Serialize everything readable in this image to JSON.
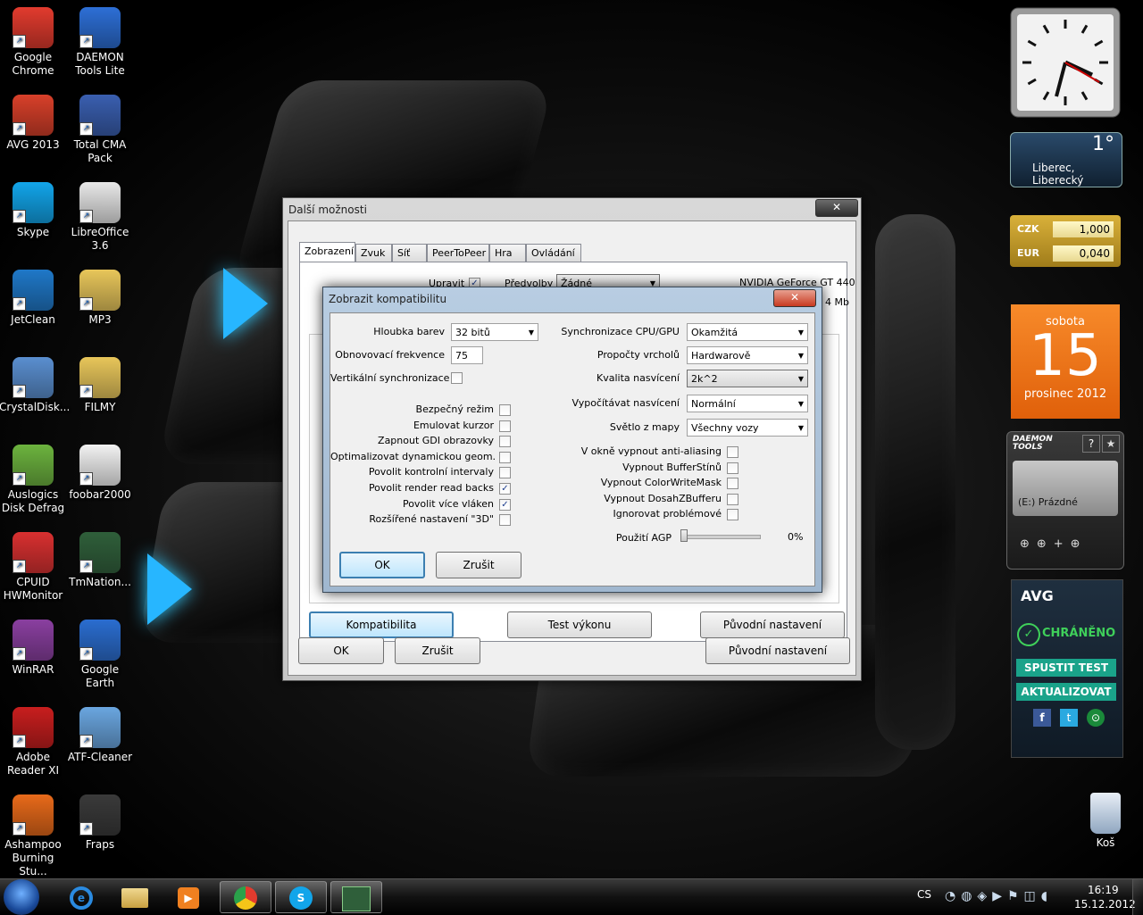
{
  "desktop": {
    "icons": [
      {
        "label1": "Google",
        "label2": "Chrome",
        "icon": "chrome-icon",
        "color": "#e23b2e"
      },
      {
        "label1": "DAEMON",
        "label2": "Tools Lite",
        "icon": "daemon-tools-icon",
        "color": "#2d6fd6"
      },
      {
        "label1": "AVG 2013",
        "label2": "",
        "icon": "avg-icon",
        "color": "#d8402a"
      },
      {
        "label1": "Total CMA",
        "label2": "Pack",
        "icon": "floppy-icon",
        "color": "#3a5fb0"
      },
      {
        "label1": "Skype",
        "label2": "",
        "icon": "skype-icon",
        "color": "#12a5ea"
      },
      {
        "label1": "LibreOffice",
        "label2": "3.6",
        "icon": "document-icon",
        "color": "#e8e8e8"
      },
      {
        "label1": "JetClean",
        "label2": "",
        "icon": "jetclean-icon",
        "color": "#1f78c8"
      },
      {
        "label1": "MP3",
        "label2": "",
        "icon": "folder-icon",
        "color": "#e8c65a"
      },
      {
        "label1": "CrystalDisk...",
        "label2": "",
        "icon": "crystaldisk-icon",
        "color": "#5a8fd0"
      },
      {
        "label1": "FILMY",
        "label2": "",
        "icon": "folder-icon",
        "color": "#e8c65a"
      },
      {
        "label1": "Auslogics",
        "label2": "Disk Defrag",
        "icon": "defrag-icon",
        "color": "#6cb33e"
      },
      {
        "label1": "foobar2000",
        "label2": "",
        "icon": "foobar-icon",
        "color": "#f2f2f2"
      },
      {
        "label1": "CPUID",
        "label2": "HWMonitor",
        "icon": "hwmonitor-icon",
        "color": "#d93030"
      },
      {
        "label1": "TmNation...",
        "label2": "",
        "icon": "tmnations-icon",
        "color": "#2f5f3a"
      },
      {
        "label1": "WinRAR",
        "label2": "",
        "icon": "winrar-icon",
        "color": "#8a3fa0"
      },
      {
        "label1": "Google Earth",
        "label2": "",
        "icon": "google-earth-icon",
        "color": "#2a6dd0"
      },
      {
        "label1": "Adobe",
        "label2": "Reader XI",
        "icon": "adobe-reader-icon",
        "color": "#c81e1e"
      },
      {
        "label1": "ATF-Cleaner",
        "label2": "",
        "icon": "atf-cleaner-icon",
        "color": "#6aa6e0"
      },
      {
        "label1": "Ashampoo",
        "label2": "Burning Stu...",
        "icon": "ashampoo-icon",
        "color": "#e86a1a"
      },
      {
        "label1": "Fraps",
        "label2": "",
        "icon": "fraps-icon",
        "color": "#3a3a3a"
      }
    ],
    "recycle_bin": "Koš"
  },
  "gadgets": {
    "weather": {
      "temp": "1°",
      "place": "Liberec, Liberecký"
    },
    "currency": [
      {
        "code": "CZK",
        "value": "1,000"
      },
      {
        "code": "EUR",
        "value": "0,040"
      }
    ],
    "calendar": {
      "weekday": "sobota",
      "day": "15",
      "month_year": "prosinec 2012"
    },
    "daemon": {
      "brand": "DAEMON TOOLS",
      "help": "?",
      "drive": "(E:) Prázdné"
    },
    "avg": {
      "brand": "AVG",
      "status": "CHRÁNĚNO",
      "btn_test": "SPUSTIT TEST",
      "btn_update": "AKTUALIZOVAT"
    }
  },
  "main_window": {
    "title": "Další možnosti",
    "close": "✕",
    "tabs": [
      "Zobrazení",
      "Zvuk",
      "Síť",
      "PeerToPeer",
      "Hra",
      "Ovládání"
    ],
    "upravit_label": "Upravit",
    "predvolby_label": "Předvolby",
    "predvolby_value": "Žádné",
    "gpu_name": "NVIDIA GeForce GT 440",
    "mem_suffix": "4 Mb",
    "btn_compat": "Kompatibilita",
    "btn_perf": "Test výkonu",
    "btn_default_inner": "Původní nastavení",
    "btn_ok": "OK",
    "btn_cancel": "Zrušit",
    "btn_default": "Původní nastavení"
  },
  "compat_dialog": {
    "title": "Zobrazit kompatibilitu",
    "close": "✕",
    "color_depth_label": "Hloubka barev",
    "color_depth_value": "32 bitů",
    "refresh_label": "Obnovovací frekvence",
    "refresh_value": "75",
    "vsync_label": "Vertikální synchronizace",
    "left_checks": [
      {
        "label": "Bezpečný režim",
        "checked": false
      },
      {
        "label": "Emulovat kurzor",
        "checked": false
      },
      {
        "label": "Zapnout GDI obrazovky",
        "checked": false
      },
      {
        "label": "Optimalizovat dynamickou geom.",
        "checked": false
      },
      {
        "label": "Povolit kontrolní intervaly",
        "checked": false
      },
      {
        "label": "Povolit render read backs",
        "checked": true
      },
      {
        "label": "Povolit více vláken",
        "checked": true
      },
      {
        "label": "Rozšířené nastavení \"3D\"",
        "checked": false
      }
    ],
    "right_selects": [
      {
        "label": "Synchronizace CPU/GPU",
        "value": "Okamžitá"
      },
      {
        "label": "Propočty vrcholů",
        "value": "Hardwarově"
      },
      {
        "label": "Kvalita nasvícení",
        "value": "2k^2"
      },
      {
        "label": "Vypočítávat nasvícení",
        "value": "Normální"
      },
      {
        "label": "Světlo z mapy",
        "value": "Všechny vozy"
      }
    ],
    "right_checks": [
      {
        "label": "V okně vypnout anti-aliasing",
        "checked": false
      },
      {
        "label": "Vypnout BufferStínů",
        "checked": false
      },
      {
        "label": "Vypnout ColorWriteMask",
        "checked": false
      },
      {
        "label": "Vypnout DosahZBufferu",
        "checked": false
      },
      {
        "label": "Ignorovat problémové",
        "checked": false
      }
    ],
    "agp_label": "Použití AGP",
    "agp_value": "0%",
    "agp_fraction": 0,
    "btn_ok": "OK",
    "btn_cancel": "Zrušit"
  },
  "taskbar": {
    "lang": "CS",
    "time": "16:19",
    "date": "15.12.2012",
    "items": [
      "start-orb",
      "internet-explorer-icon",
      "explorer-icon",
      "media-player-icon",
      "chrome-icon",
      "skype-icon",
      "tmnations-icon"
    ]
  }
}
